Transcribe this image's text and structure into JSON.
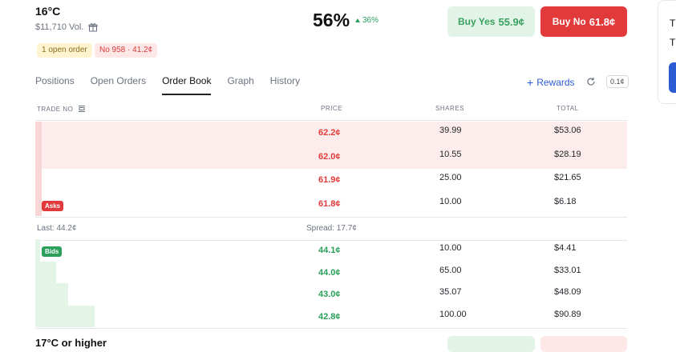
{
  "market": {
    "title": "16°C",
    "volume": "$11,710 Vol.",
    "open_order_pill": "1 open order",
    "position_pill": "No 958 · 41.2¢",
    "probability": "56%",
    "delta": "36%",
    "buy_yes_label": "Buy Yes",
    "buy_yes_price": "55.9¢",
    "buy_no_label": "Buy No",
    "buy_no_price": "61.8¢"
  },
  "tabs": [
    {
      "label": "Positions"
    },
    {
      "label": "Open Orders"
    },
    {
      "label": "Order Book",
      "active": true
    },
    {
      "label": "Graph"
    },
    {
      "label": "History"
    }
  ],
  "toolbar": {
    "rewards": "Rewards",
    "tick_size": "0.1¢"
  },
  "table": {
    "headers": {
      "trade": "TRADE NO",
      "price": "PRICE",
      "shares": "SHARES",
      "total": "TOTAL"
    },
    "asks": [
      {
        "price": "62.2¢",
        "shares": "39.99",
        "total": "$53.06",
        "depth": 1.0
      },
      {
        "price": "62.0¢",
        "shares": "10.55",
        "total": "$28.19",
        "depth": 0.45
      },
      {
        "price": "61.9¢",
        "shares": "25.00",
        "total": "$21.65",
        "depth": 0.3
      },
      {
        "price": "61.8¢",
        "shares": "10.00",
        "total": "$6.18",
        "depth": 0.12
      }
    ],
    "asks_label": "Asks",
    "last": "Last: 44.2¢",
    "spread": "Spread: 17.7¢",
    "bids_label": "Bids",
    "bids": [
      {
        "price": "44.1¢",
        "shares": "10.00",
        "total": "$4.41",
        "depth": 0.05
      },
      {
        "price": "44.0¢",
        "shares": "65.00",
        "total": "$33.01",
        "depth": 0.35
      },
      {
        "price": "43.0¢",
        "shares": "35.07",
        "total": "$48.09",
        "depth": 0.55
      },
      {
        "price": "42.8¢",
        "shares": "100.00",
        "total": "$90.89",
        "depth": 1.0
      }
    ]
  },
  "next_market": {
    "title": "17°C or higher"
  },
  "side_panel": {
    "line1": "T",
    "line2": "T"
  },
  "colors": {
    "ask": "#e23a3a",
    "bid": "#2aa05a",
    "accent": "#2d5bd3"
  }
}
